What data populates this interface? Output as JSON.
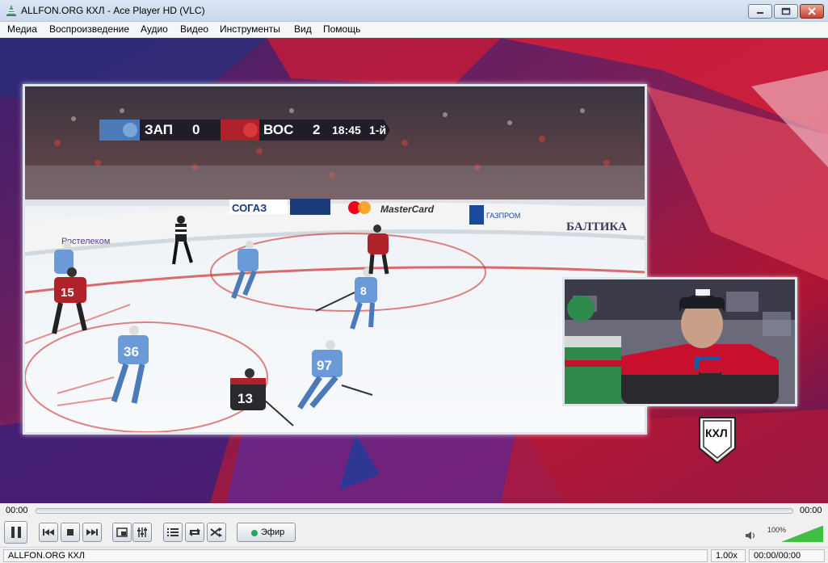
{
  "window": {
    "title": "ALLFON.ORG КХЛ - Ace Player HD (VLC)",
    "icon": "vlc-cone-icon",
    "controls": [
      "minimize-icon",
      "maximize-icon",
      "close-icon"
    ]
  },
  "menu": {
    "items": [
      "Медиа",
      "Воспроизведение",
      "Аудио",
      "Видео",
      "Инструменты",
      "Вид",
      "Помощь"
    ]
  },
  "video": {
    "scoreboard": {
      "home_team": "ЗАП",
      "home_score": "0",
      "away_team": "ВОС",
      "away_score": "2",
      "clock": "18:45",
      "period": "1-й"
    },
    "boards": [
      "Ростелеком",
      "СОГАЗ",
      "MasterCard",
      "ГАЗПРОМ",
      "БАЛТИКА"
    ],
    "jerseys": [
      "15",
      "36",
      "97",
      "8",
      "13"
    ],
    "logo": "КХЛ"
  },
  "seek": {
    "elapsed": "00:00",
    "total": "00:00",
    "progress": 0
  },
  "controls": {
    "buttons": [
      "pause-icon",
      "previous-icon",
      "stop-icon",
      "next-icon",
      "fullscreen-icon",
      "equalizer-icon",
      "playlist-icon",
      "loop-icon",
      "shuffle-icon"
    ],
    "live_label": "Эфир",
    "volume_percent": "100%",
    "volume_level": 1.0
  },
  "status": {
    "title": "ALLFON.ORG КХЛ",
    "rate": "1.00x",
    "time": "00:00/00:00"
  },
  "colors": {
    "live_dot": "#2ca25f",
    "volume_fill": "#3fbf3f",
    "background_red": "#c8102e",
    "background_purple": "#5a1a55"
  }
}
